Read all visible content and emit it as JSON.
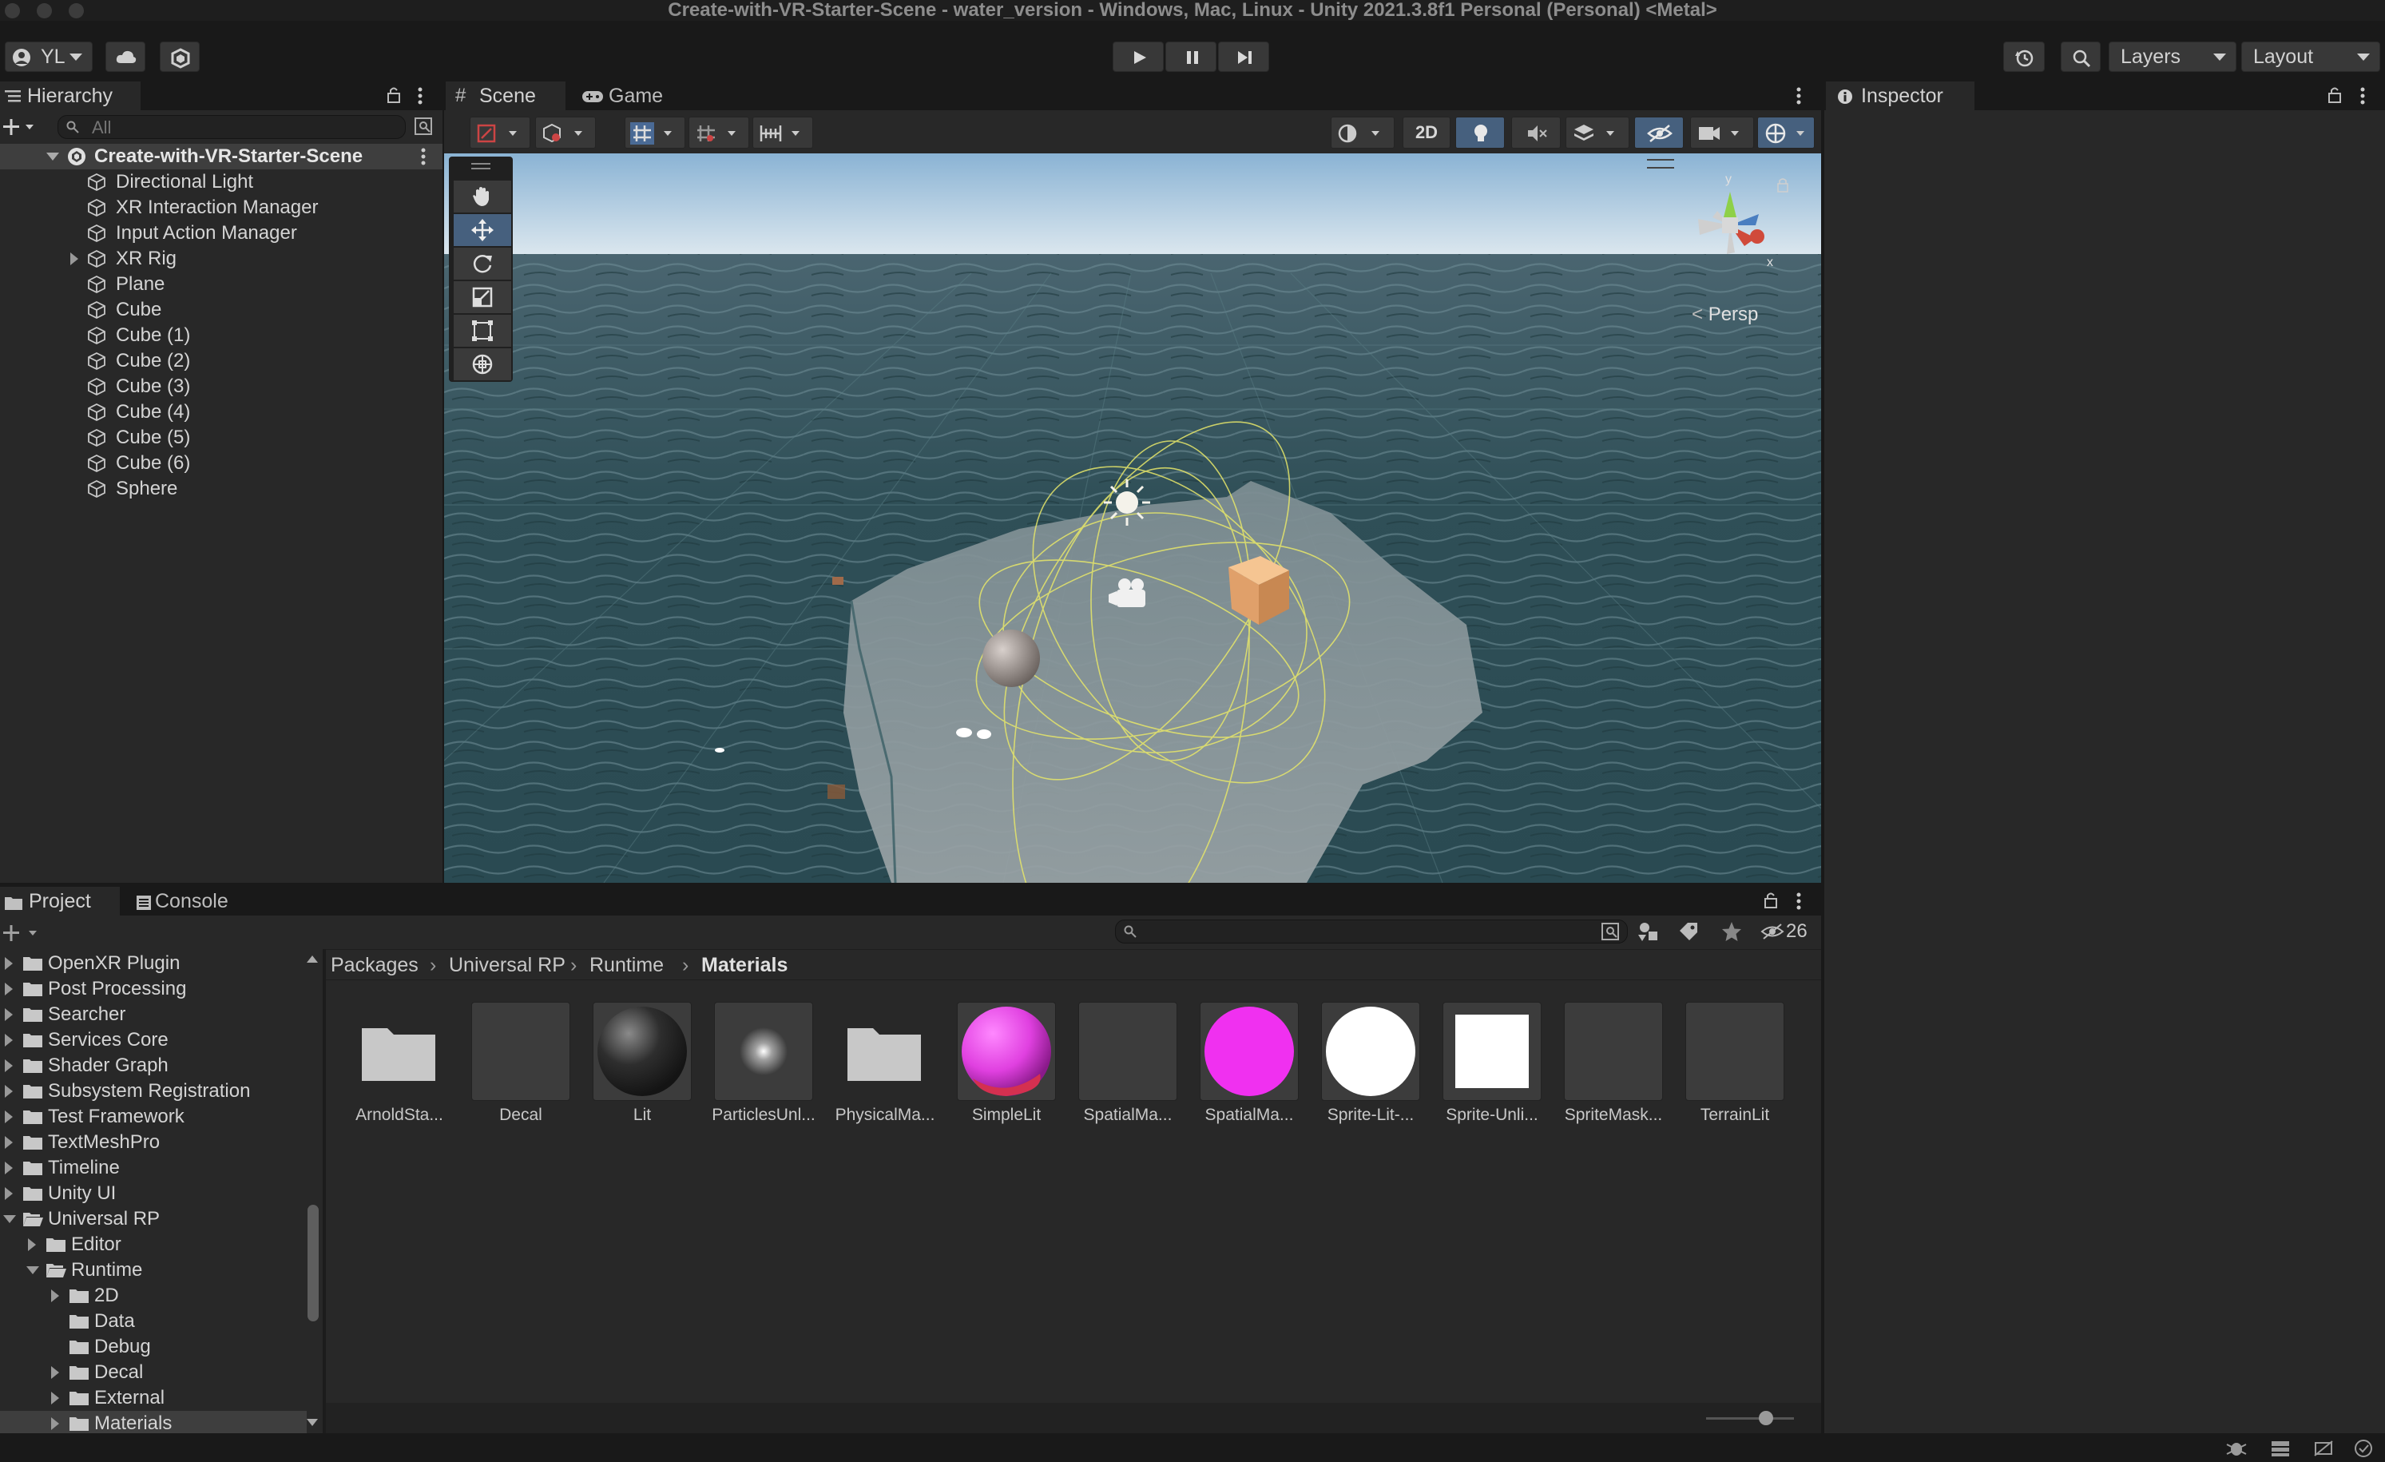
{
  "window": {
    "title": "Create-with-VR-Starter-Scene - water_version - Windows, Mac, Linux - Unity 2021.3.8f1 Personal (Personal) <Metal>"
  },
  "toolbar": {
    "account_label": "YL",
    "layers_label": "Layers",
    "layout_label": "Layout",
    "icons": {
      "account": "account-icon",
      "cloud": "cloud-icon",
      "collab": "collab-icon",
      "play": "play-icon",
      "pause": "pause-icon",
      "step": "step-icon",
      "history": "history-icon",
      "search": "search-icon"
    }
  },
  "hierarchy": {
    "tab_label": "Hierarchy",
    "search_placeholder": "All",
    "scene_name": "Create-with-VR-Starter-Scene",
    "items": [
      {
        "label": "Directional Light"
      },
      {
        "label": "XR Interaction Manager"
      },
      {
        "label": "Input Action Manager"
      },
      {
        "label": "XR Rig"
      },
      {
        "label": "Plane"
      },
      {
        "label": "Cube"
      },
      {
        "label": "Cube (1)"
      },
      {
        "label": "Cube (2)"
      },
      {
        "label": "Cube (3)"
      },
      {
        "label": "Cube (4)"
      },
      {
        "label": "Cube (5)"
      },
      {
        "label": "Cube (6)"
      },
      {
        "label": "Sphere"
      }
    ]
  },
  "scene_view": {
    "tabs": [
      {
        "label": "Scene"
      },
      {
        "label": "Game"
      }
    ],
    "toggle_2d": "2D",
    "persp_label": "Persp",
    "gizmo_axes": {
      "y": "y",
      "x": "x"
    }
  },
  "inspector": {
    "tab_label": "Inspector"
  },
  "project": {
    "tabs": [
      {
        "label": "Project"
      },
      {
        "label": "Console"
      }
    ],
    "hidden_count": "26",
    "tree": [
      {
        "label": "OpenXR Plugin"
      },
      {
        "label": "Post Processing"
      },
      {
        "label": "Searcher"
      },
      {
        "label": "Services Core"
      },
      {
        "label": "Shader Graph"
      },
      {
        "label": "Subsystem Registration"
      },
      {
        "label": "Test Framework"
      },
      {
        "label": "TextMeshPro"
      },
      {
        "label": "Timeline"
      },
      {
        "label": "Unity UI"
      },
      {
        "label": "Universal RP"
      },
      {
        "label": "Editor"
      },
      {
        "label": "Runtime"
      },
      {
        "label": "2D"
      },
      {
        "label": "Data"
      },
      {
        "label": "Debug"
      },
      {
        "label": "Decal"
      },
      {
        "label": "External"
      },
      {
        "label": "Materials"
      }
    ],
    "breadcrumb": [
      "Packages",
      "Universal RP",
      "Runtime",
      "Materials"
    ],
    "assets": [
      {
        "label": "ArnoldSta...",
        "kind": "folder"
      },
      {
        "label": "Decal",
        "kind": "blank"
      },
      {
        "label": "Lit",
        "kind": "sphere-dark"
      },
      {
        "label": "ParticlesUnl...",
        "kind": "particle"
      },
      {
        "label": "PhysicalMa...",
        "kind": "folder"
      },
      {
        "label": "SimpleLit",
        "kind": "sphere-magenta-shaded"
      },
      {
        "label": "SpatialMa...",
        "kind": "blank"
      },
      {
        "label": "SpatialMa...",
        "kind": "sphere-magenta"
      },
      {
        "label": "Sprite-Lit-...",
        "kind": "circle-white"
      },
      {
        "label": "Sprite-Unli...",
        "kind": "square-white"
      },
      {
        "label": "SpriteMask...",
        "kind": "blank"
      },
      {
        "label": "TerrainLit",
        "kind": "blank"
      }
    ]
  }
}
